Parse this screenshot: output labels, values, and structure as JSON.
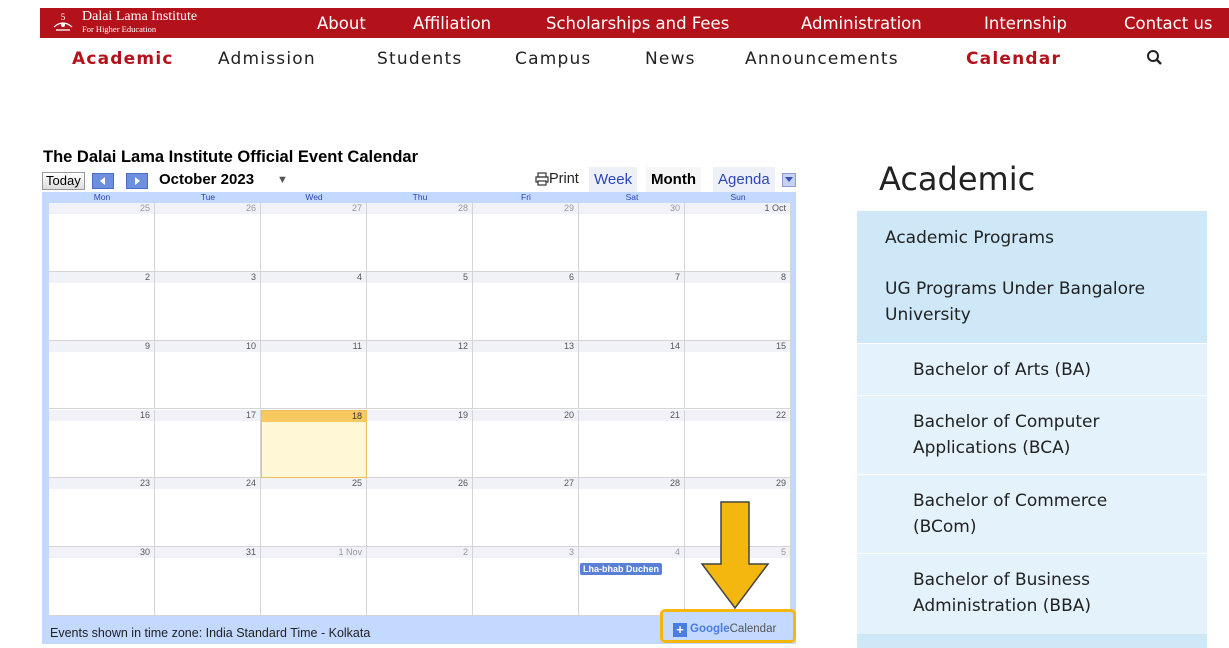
{
  "brand": {
    "name": "Dalai Lama Institute",
    "subtitle": "For Higher Education",
    "logo_icon": "institute-emblem-icon",
    "color": "#b3121b"
  },
  "top_nav": [
    {
      "label": "About"
    },
    {
      "label": "Affiliation"
    },
    {
      "label": "Scholarships and Fees"
    },
    {
      "label": "Administration"
    },
    {
      "label": "Internship"
    },
    {
      "label": "Contact us"
    }
  ],
  "sub_nav": [
    {
      "label": "Academic",
      "active": true
    },
    {
      "label": "Admission"
    },
    {
      "label": "Students"
    },
    {
      "label": "Campus"
    },
    {
      "label": "News"
    },
    {
      "label": "Announcements"
    },
    {
      "label": "Calendar",
      "active": true
    }
  ],
  "search_icon": "search-icon",
  "calendar": {
    "title": "The Dalai Lama Institute Official Event Calendar",
    "today_label": "Today",
    "month_label": "October 2023",
    "print_label": "Print",
    "views": [
      "Week",
      "Month",
      "Agenda"
    ],
    "active_view": "Month",
    "weekdays": [
      "Mon",
      "Tue",
      "Wed",
      "Thu",
      "Fri",
      "Sat",
      "Sun"
    ],
    "weeks": [
      [
        "25",
        "26",
        "27",
        "28",
        "29",
        "30",
        "1 Oct"
      ],
      [
        "2",
        "3",
        "4",
        "5",
        "6",
        "7",
        "8"
      ],
      [
        "9",
        "10",
        "11",
        "12",
        "13",
        "14",
        "15"
      ],
      [
        "16",
        "17",
        "18",
        "19",
        "20",
        "21",
        "22"
      ],
      [
        "23",
        "24",
        "25",
        "26",
        "27",
        "28",
        "29"
      ],
      [
        "30",
        "31",
        "1 Nov",
        "2",
        "3",
        "4",
        "5"
      ]
    ],
    "today": "18",
    "events": [
      {
        "label": "Lha-bhab Duchen",
        "date": "4 Nov"
      }
    ],
    "timezone_text": "Events shown in time zone: India Standard Time - Kolkata",
    "gcal": {
      "brand": "Google",
      "label": "Calendar"
    },
    "highlight_color": "#f4b70f"
  },
  "sidebar": {
    "title": "Academic",
    "items": [
      {
        "label": "Academic Programs",
        "level": 1
      },
      {
        "label": "UG Programs Under Bangalore University",
        "level": 1
      },
      {
        "label": "Bachelor of Arts (BA)",
        "level": 2
      },
      {
        "label": "Bachelor of Computer Applications (BCA)",
        "level": 2
      },
      {
        "label": "Bachelor of Commerce (BCom)",
        "level": 2
      },
      {
        "label": "Bachelor of Business Administration (BBA)",
        "level": 2
      }
    ]
  }
}
